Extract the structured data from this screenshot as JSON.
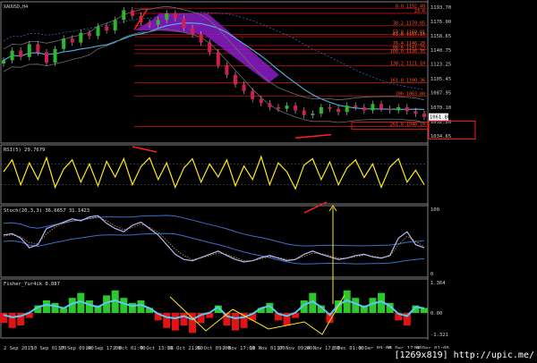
{
  "chart_data": {
    "type": "line",
    "symbol": "XAUUSD,H4",
    "price": {
      "y_range": [
        1030,
        1196
      ],
      "axis_ticks": [
        "1193.70",
        "1176.00",
        "1158.65",
        "1140.75",
        "1123.25",
        "1105.45",
        "1087.95",
        "1070.10",
        "1052.20",
        "1034.65"
      ],
      "fib_levels": [
        {
          "label": "0.0 1192.40",
          "value": 1192.4
        },
        {
          "label": "23.6",
          "value": 1186.1
        },
        {
          "label": "38.2 1170.85",
          "value": 1170.85
        },
        {
          "label": "50.0 1160.01",
          "value": 1160.01
        },
        {
          "label": "61.8 1157.15",
          "value": 1157.15
        },
        {
          "label": "76.4 1146.20",
          "value": 1146.2
        },
        {
          "label": "88.6 1141.25",
          "value": 1141.25
        },
        {
          "label": "100.0 1136.35",
          "value": 1136.35
        },
        {
          "label": "138.2 1121.10",
          "value": 1121.1
        },
        {
          "label": "161.8 1100.36",
          "value": 1100.36
        },
        {
          "label": "200 1083.80",
          "value": 1083.8
        },
        {
          "label": "261.8 1046.10",
          "value": 1046.1
        }
      ],
      "current_tag": "1061.80",
      "close": [
        1128,
        1140,
        1132,
        1148,
        1138,
        1125,
        1142,
        1155,
        1150,
        1162,
        1158,
        1170,
        1165,
        1178,
        1190,
        1183,
        1175,
        1172,
        1178,
        1186,
        1180,
        1168,
        1160,
        1150,
        1138,
        1122,
        1110,
        1098,
        1090,
        1080,
        1075,
        1070,
        1068,
        1072,
        1066,
        1060,
        1062,
        1070,
        1068,
        1064,
        1072,
        1070,
        1066,
        1074,
        1068,
        1066,
        1070,
        1065,
        1062,
        1058
      ]
    },
    "rsi": {
      "label": "RSI(5) 29.7679",
      "values": [
        55,
        78,
        30,
        72,
        40,
        82,
        25,
        60,
        78,
        35,
        70,
        28,
        75,
        45,
        80,
        30,
        65,
        82,
        40,
        72,
        25,
        62,
        80,
        35,
        70,
        45,
        78,
        28,
        66,
        40,
        84,
        30,
        72,
        55,
        22,
        68,
        80,
        40,
        74,
        30,
        62,
        78,
        44,
        70,
        25,
        64,
        80,
        35,
        58,
        30
      ]
    },
    "stoch": {
      "label": "Stoch(20,3,3) 36.6657 31.1423",
      "axis_ticks": [
        "100",
        "0"
      ],
      "main": [
        60,
        62,
        55,
        40,
        45,
        70,
        75,
        80,
        85,
        82,
        88,
        90,
        78,
        70,
        65,
        75,
        80,
        70,
        60,
        45,
        30,
        22,
        20,
        25,
        30,
        35,
        28,
        22,
        18,
        20,
        25,
        28,
        24,
        20,
        22,
        30,
        35,
        30,
        26,
        22,
        24,
        28,
        30,
        26,
        24,
        28,
        55,
        65,
        45,
        40
      ],
      "signal": [
        58,
        60,
        57,
        48,
        46,
        62,
        72,
        78,
        82,
        83,
        86,
        88,
        82,
        74,
        68,
        72,
        77,
        72,
        64,
        52,
        38,
        28,
        22,
        24,
        28,
        32,
        30,
        25,
        20,
        20,
        23,
        26,
        25,
        22,
        22,
        27,
        32,
        31,
        28,
        24,
        24,
        26,
        29,
        27,
        25,
        27,
        45,
        58,
        50,
        42
      ]
    },
    "fisher": {
      "label": "Fisher_Yur4ik 0.087",
      "axis_ticks": [
        "1.364",
        "0.00",
        "-1.321"
      ],
      "hist": [
        -0.4,
        -0.6,
        -0.5,
        -0.2,
        0.3,
        0.5,
        0.4,
        0.2,
        0.6,
        0.8,
        0.5,
        0.3,
        0.7,
        0.9,
        0.6,
        0.4,
        0.5,
        0.2,
        -0.3,
        -0.6,
        -0.7,
        -0.5,
        -0.8,
        -0.4,
        -0.2,
        0.3,
        -0.5,
        -0.7,
        -0.6,
        -0.3,
        0.2,
        0.4,
        -0.3,
        -0.5,
        -0.2,
        0.5,
        0.8,
        0.3,
        -0.4,
        0.5,
        0.9,
        0.6,
        0.3,
        0.6,
        0.8,
        0.4,
        -0.3,
        -0.5,
        0.3,
        0.2
      ]
    },
    "x_labels": [
      "2 Sep 2015",
      "10 Sep 01:00",
      "17 Sep 09:00",
      "24 Sep 17:00",
      "2 Oct 01:00",
      "9 Oct 13:00",
      "16 Oct 21:00",
      "26 Oct 09:00",
      "2 Nov 17:00",
      "10 Nov 01:00",
      "17 Nov 09:00",
      "24 Nov 17:00",
      "2 Dec 01:00",
      "9 Dec 09:00",
      "16 Dec 17:00",
      "24 Dec 01:00"
    ]
  },
  "watermark": "[1269x819] http://upic.me/"
}
